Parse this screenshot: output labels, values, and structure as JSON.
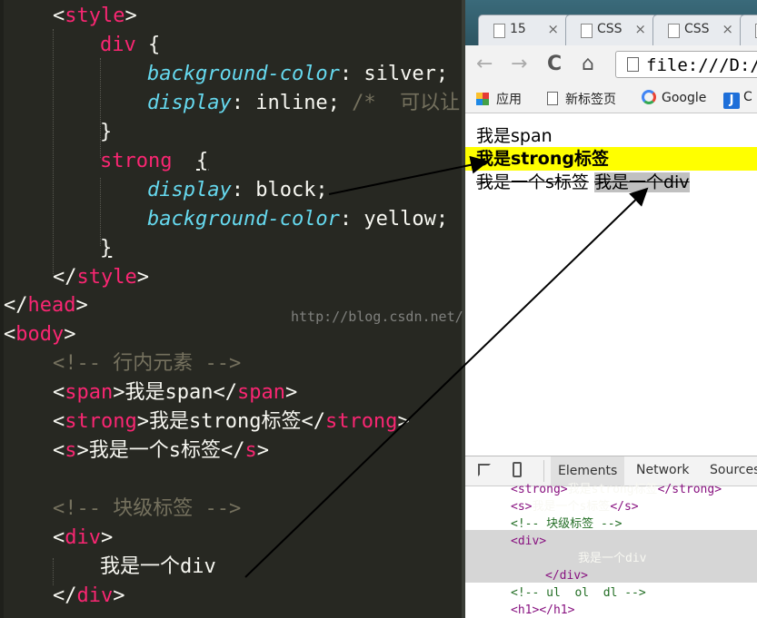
{
  "editor": {
    "lines": [
      {
        "segs": [
          {
            "c": "t",
            "v": "<"
          },
          {
            "c": "tag",
            "v": "style"
          },
          {
            "c": "t",
            "v": ">"
          }
        ]
      },
      {
        "segs": [
          {
            "c": "sel",
            "v": "div"
          },
          {
            "c": "t",
            "v": " {"
          }
        ]
      },
      {
        "segs": [
          {
            "c": "prop",
            "v": "background-color"
          },
          {
            "c": "t",
            "v": ": silver;"
          }
        ]
      },
      {
        "segs": [
          {
            "c": "prop",
            "v": "display"
          },
          {
            "c": "t",
            "v": ": inline; "
          },
          {
            "c": "cm",
            "v": "/*  可以让"
          }
        ]
      },
      {
        "segs": [
          {
            "c": "t",
            "v": "}"
          }
        ]
      },
      {
        "segs": [
          {
            "c": "sel",
            "v": "strong"
          },
          {
            "c": "t",
            "v": "  "
          },
          {
            "c": "t uline",
            "v": "{"
          }
        ]
      },
      {
        "segs": [
          {
            "c": "prop",
            "v": "display"
          },
          {
            "c": "t",
            "v": ": block;"
          }
        ]
      },
      {
        "segs": [
          {
            "c": "prop",
            "v": "background-color"
          },
          {
            "c": "t",
            "v": ": yellow;"
          }
        ]
      },
      {
        "segs": [
          {
            "c": "t uline",
            "v": "}"
          }
        ]
      },
      {
        "segs": [
          {
            "c": "t",
            "v": "</"
          },
          {
            "c": "tag",
            "v": "style"
          },
          {
            "c": "t",
            "v": ">"
          }
        ]
      },
      {
        "segs": [
          {
            "c": "t",
            "v": "</"
          },
          {
            "c": "tag",
            "v": "head"
          },
          {
            "c": "t",
            "v": ">"
          }
        ]
      },
      {
        "segs": [
          {
            "c": "t",
            "v": "<"
          },
          {
            "c": "tag",
            "v": "body"
          },
          {
            "c": "t",
            "v": ">"
          }
        ]
      },
      {
        "segs": [
          {
            "c": "cm",
            "v": "<!-- 行内元素 -->"
          }
        ]
      },
      {
        "segs": [
          {
            "c": "t",
            "v": "<"
          },
          {
            "c": "tag",
            "v": "span"
          },
          {
            "c": "t",
            "v": ">我是span</"
          },
          {
            "c": "tag",
            "v": "span"
          },
          {
            "c": "t",
            "v": ">"
          }
        ]
      },
      {
        "segs": [
          {
            "c": "t",
            "v": "<"
          },
          {
            "c": "tag",
            "v": "strong"
          },
          {
            "c": "t",
            "v": ">我是strong标签</"
          },
          {
            "c": "tag",
            "v": "strong"
          },
          {
            "c": "t",
            "v": ">"
          }
        ]
      },
      {
        "segs": [
          {
            "c": "t",
            "v": "<"
          },
          {
            "c": "tag",
            "v": "s"
          },
          {
            "c": "t",
            "v": ">我是一个s标签</"
          },
          {
            "c": "tag",
            "v": "s"
          },
          {
            "c": "t",
            "v": ">"
          }
        ]
      },
      {
        "segs": []
      },
      {
        "segs": [
          {
            "c": "cm",
            "v": "<!-- 块级标签 -->"
          }
        ]
      },
      {
        "segs": [
          {
            "c": "t",
            "v": "<"
          },
          {
            "c": "tag",
            "v": "div"
          },
          {
            "c": "t",
            "v": ">"
          }
        ]
      },
      {
        "segs": [
          {
            "c": "t",
            "v": "我是一个div"
          }
        ]
      },
      {
        "segs": [
          {
            "c": "t",
            "v": "</"
          },
          {
            "c": "tag",
            "v": "div"
          },
          {
            "c": "t",
            "v": ">"
          }
        ]
      }
    ]
  },
  "browser": {
    "tabs": [
      {
        "label": "15",
        "close": "×"
      },
      {
        "label": "CSS",
        "close": "×"
      },
      {
        "label": "CSS",
        "close": "×"
      }
    ],
    "nav": {
      "back": "←",
      "forward": "→",
      "reload": "C",
      "home": "⌂"
    },
    "address": "file:///D:/C",
    "bookmarks": [
      {
        "label": "应用",
        "icon": "apps-grid-icon"
      },
      {
        "label": "新标签页",
        "icon": "page-icon"
      },
      {
        "label": "Google",
        "icon": "google-icon"
      },
      {
        "label": "C",
        "icon": "j-icon"
      }
    ],
    "page": {
      "span_text": "我是span",
      "strong_text": "我是strong标签",
      "s_text": "我是一个s标签",
      "div_text": "我是一个div"
    },
    "devtools": {
      "tabs": [
        "Elements",
        "Network",
        "Sources"
      ],
      "dom_lines": [
        {
          "indent": 50,
          "segs": [
            {
              "c": "dtag",
              "v": "<strong>"
            },
            {
              "c": "t",
              "v": "我是strong标签"
            },
            {
              "c": "dtag",
              "v": "</strong>"
            }
          ]
        },
        {
          "indent": 50,
          "segs": [
            {
              "c": "dtag",
              "v": "<s>"
            },
            {
              "c": "t",
              "v": "我是一个s标签"
            },
            {
              "c": "dtag",
              "v": "</s>"
            }
          ]
        },
        {
          "indent": 50,
          "segs": [
            {
              "c": "dcm",
              "v": "<!-- 块级标签 -->"
            }
          ]
        },
        {
          "indent": 50,
          "segs": [
            {
              "c": "dtag",
              "v": "<div>"
            }
          ]
        },
        {
          "indent": 124,
          "segs": [
            {
              "c": "t",
              "v": "我是一个div"
            }
          ]
        },
        {
          "indent": 88,
          "segs": [
            {
              "c": "dtag",
              "v": "</div>"
            }
          ]
        },
        {
          "indent": 50,
          "segs": [
            {
              "c": "dcm",
              "v": "<!-- ul  ol  dl -->"
            }
          ]
        },
        {
          "indent": 50,
          "segs": [
            {
              "c": "dtag",
              "v": "<h1>"
            },
            {
              "c": "dtag",
              "v": "</h1>"
            }
          ]
        }
      ]
    }
  },
  "watermark": "http://blog.csdn.net/",
  "colors": {
    "editor_bg": "#272822",
    "tag": "#f92672",
    "prop": "#66d9ef",
    "comment": "#75715e",
    "highlight_yellow": "#ffff00",
    "silver": "#c0c0c0"
  }
}
